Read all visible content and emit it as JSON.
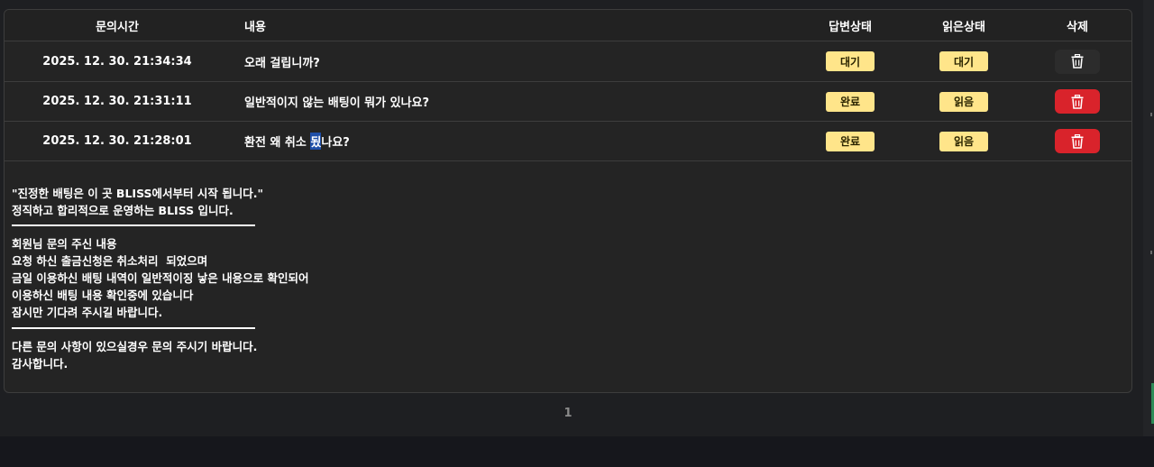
{
  "table": {
    "headers": {
      "time": "문의시간",
      "content": "내용",
      "answer_status": "답변상태",
      "read_status": "읽은상태",
      "delete": "삭제"
    },
    "rows": [
      {
        "time": "2025. 12. 30. 21:34:34",
        "content": "오래 걸립니까?",
        "answer_status": "대기",
        "read_status": "대기",
        "delete_style": "dark"
      },
      {
        "time": "2025. 12. 30. 21:31:11",
        "content": "일반적이지 않는 배팅이 뭐가 있나요?",
        "answer_status": "완료",
        "read_status": "읽음",
        "delete_style": "red"
      },
      {
        "time": "2025. 12. 30. 21:28:01",
        "content_before": "환전 왜 취소 ",
        "content_highlight": "됬",
        "content_after": "나요?",
        "answer_status": "완료",
        "read_status": "읽음",
        "delete_style": "red"
      }
    ]
  },
  "answer": {
    "intro": "\"진정한 배팅은 이 곳 BLISS에서부터 시작 됩니다.\"\n정직하고 합리적으로 운영하는 BLISS 입니다.",
    "body": "회원님 문의 주신 내용\n요청 하신 출금신청은 취소처리  되었으며\n금일 이용하신 배팅 내역이 일반적이징 낳은 내용으로 확인되어\n이용하신 배팅 내용 확인중에 있습니다\n잠시만 기다려 주시길 바랍니다.",
    "closing": "다른 문의 사항이 있으실경우 문의 주시기 바랍니다.\n감사합니다."
  },
  "pagination": {
    "current": "1"
  },
  "colors": {
    "badge": "#ffe58a",
    "delete_red": "#d9232b",
    "delete_dark": "#2c2c2c",
    "background": "#1e1f22"
  },
  "icons": {
    "delete": "trash-icon"
  }
}
